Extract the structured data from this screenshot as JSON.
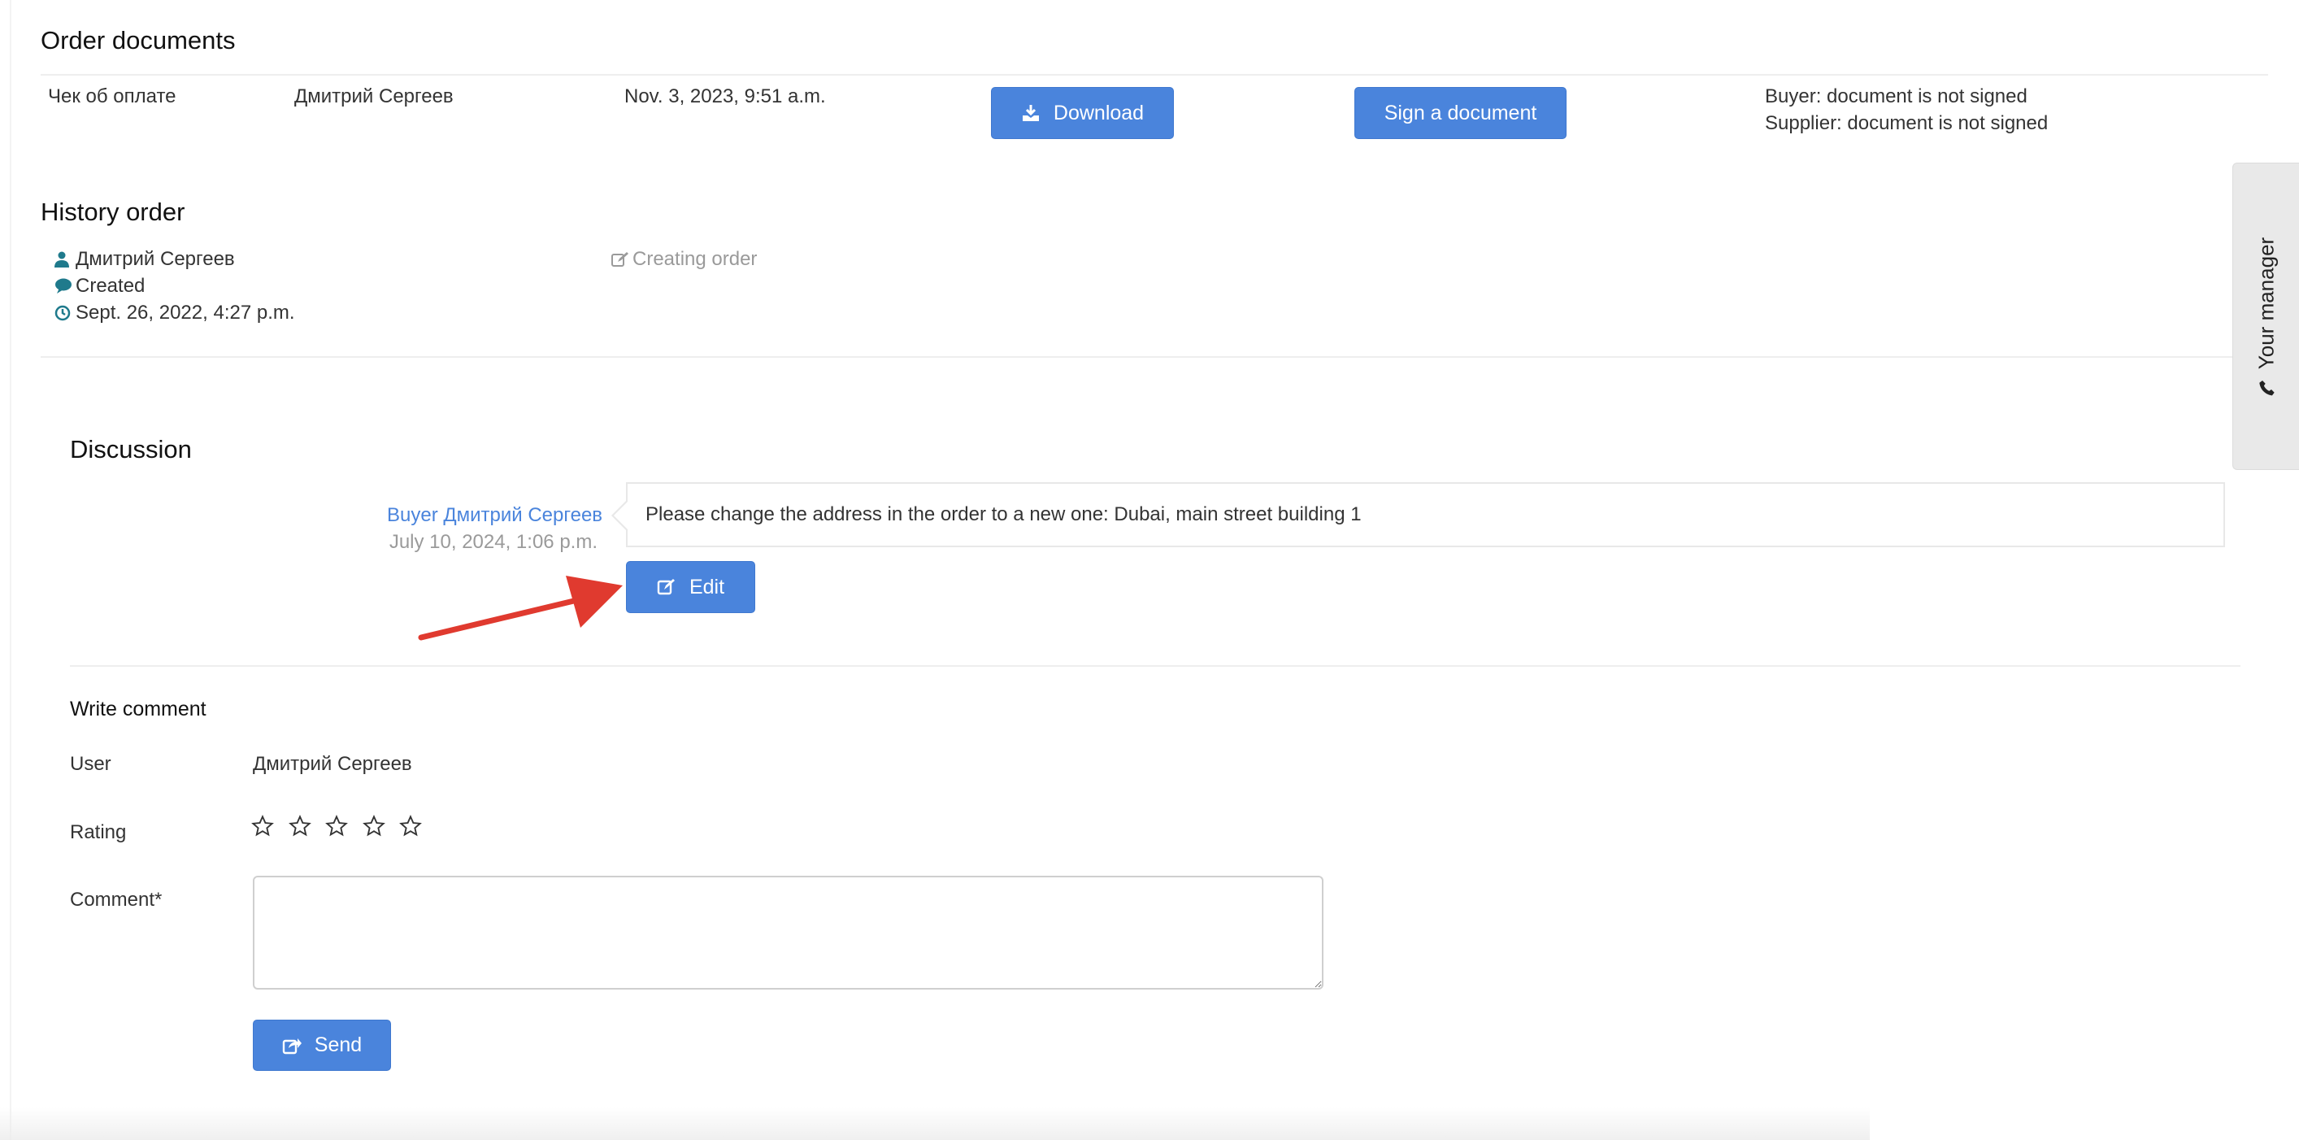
{
  "order_documents": {
    "title": "Order documents",
    "row": {
      "doc_name": "Чек об оплате",
      "person": "Дмитрий Сергеев",
      "date": "Nov. 3, 2023, 9:51 a.m.",
      "download_label": "Download",
      "sign_label": "Sign a document",
      "buyer_status": "Buyer: document is not signed",
      "supplier_status": "Supplier: document is not signed"
    }
  },
  "history": {
    "title": "History order",
    "user": "Дмитрий Сергеев",
    "status": "Created",
    "date": "Sept. 26, 2022, 4:27 p.m.",
    "action": "Creating order"
  },
  "discussion": {
    "title": "Discussion",
    "message": {
      "author": "Buyer Дмитрий Сергеев",
      "date": "July 10, 2024, 1:06 p.m.",
      "text": "Please change the address in the order to a new one: Dubai, main street building 1",
      "edit_label": "Edit"
    }
  },
  "comment_form": {
    "title": "Write comment",
    "user_label": "User",
    "user_value": "Дмитрий Сергеев",
    "rating_label": "Rating",
    "rating_value": 0,
    "rating_max": 5,
    "comment_label": "Comment*",
    "comment_value": "",
    "send_label": "Send"
  },
  "side_tab": {
    "label": "Your manager",
    "icon": "phone-icon"
  },
  "colors": {
    "accent": "#4a84dc",
    "annotation_arrow": "#e03a2f",
    "icon_teal": "#1f7a8c"
  }
}
